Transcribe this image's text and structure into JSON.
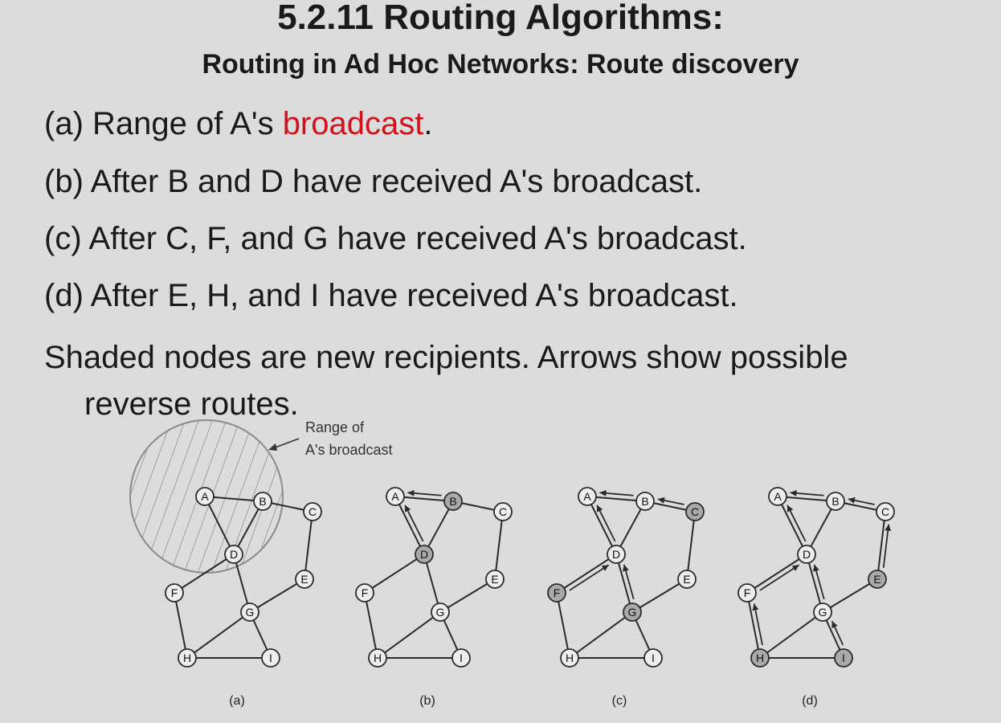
{
  "slide": {
    "title": "5.2.11 Routing Algorithms:",
    "subtitle": "Routing in Ad Hoc Networks: Route discovery",
    "items": [
      {
        "before": "(a) Range of A's ",
        "highlight": "broadcast",
        "after": "."
      },
      {
        "text": "(b) After B and D have received A's broadcast."
      },
      {
        "text": "(c) After C, F, and G have received A's broadcast."
      },
      {
        "text": "(d) After E, H, and I have received A's broadcast."
      }
    ],
    "note_line1": "Shaded nodes are new recipients.  Arrows show possible",
    "note_line2": "reverse routes.",
    "highlight_color": "#d0121b"
  },
  "figure": {
    "range_label_line1": "Range of",
    "range_label_line2": "A's broadcast",
    "node_names": [
      "A",
      "B",
      "C",
      "D",
      "E",
      "F",
      "G",
      "H",
      "I"
    ],
    "edges": [
      [
        "A",
        "B"
      ],
      [
        "A",
        "D"
      ],
      [
        "B",
        "D"
      ],
      [
        "B",
        "C"
      ],
      [
        "C",
        "E"
      ],
      [
        "D",
        "F"
      ],
      [
        "D",
        "G"
      ],
      [
        "E",
        "G"
      ],
      [
        "F",
        "H"
      ],
      [
        "G",
        "H"
      ],
      [
        "G",
        "I"
      ],
      [
        "H",
        "I"
      ]
    ],
    "panels": [
      {
        "caption": "(a)",
        "shaded": [],
        "arrows": []
      },
      {
        "caption": "(b)",
        "shaded": [
          "B",
          "D"
        ],
        "arrows": [
          [
            "B",
            "A"
          ],
          [
            "D",
            "A"
          ]
        ]
      },
      {
        "caption": "(c)",
        "shaded": [
          "C",
          "F",
          "G"
        ],
        "arrows": [
          [
            "B",
            "A"
          ],
          [
            "D",
            "A"
          ],
          [
            "C",
            "B"
          ],
          [
            "F",
            "D"
          ],
          [
            "G",
            "D"
          ]
        ]
      },
      {
        "caption": "(d)",
        "shaded": [
          "E",
          "H",
          "I"
        ],
        "arrows": [
          [
            "B",
            "A"
          ],
          [
            "D",
            "A"
          ],
          [
            "C",
            "B"
          ],
          [
            "F",
            "D"
          ],
          [
            "G",
            "D"
          ],
          [
            "E",
            "C"
          ],
          [
            "H",
            "F"
          ],
          [
            "I",
            "G"
          ]
        ]
      }
    ]
  }
}
